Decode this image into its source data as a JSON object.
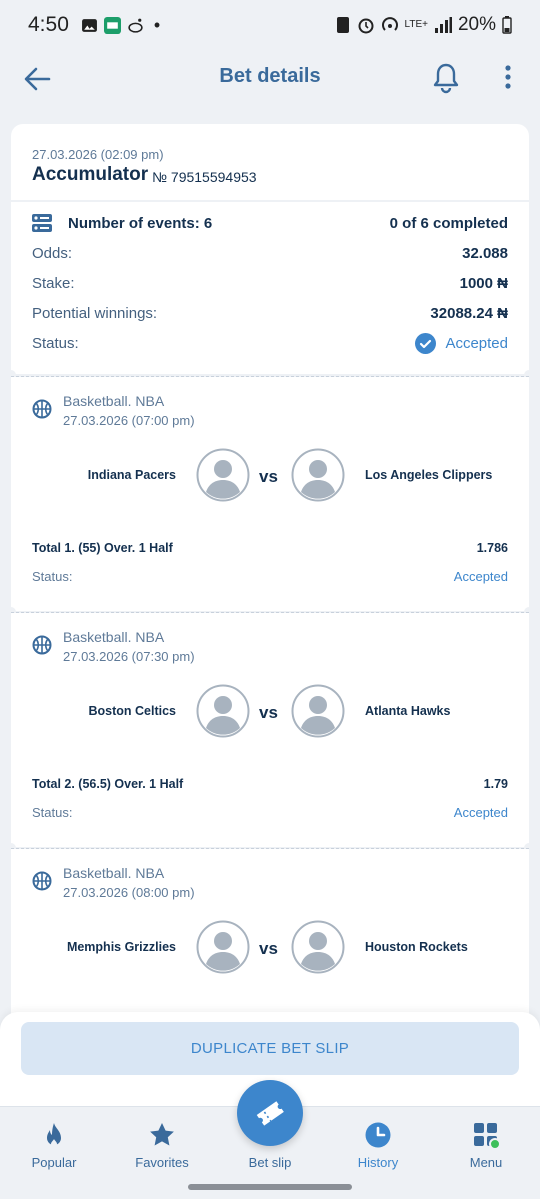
{
  "status_bar": {
    "time": "4:50",
    "network": "LTE+",
    "battery": "20%"
  },
  "app_bar": {
    "title": "Bet details"
  },
  "header": {
    "date": "27.03.2026 (02:09 pm)",
    "type": "Accumulator",
    "number": "№ 79515594953"
  },
  "summary": {
    "events_label": "Number of events: 6",
    "completed": "0 of 6 completed",
    "odds_label": "Odds:",
    "odds_value": "32.088",
    "stake_label": "Stake:",
    "stake_value": "1000 ₦",
    "winnings_label": "Potential winnings:",
    "winnings_value": "32088.24 ₦",
    "status_label": "Status:",
    "status_value": "Accepted"
  },
  "events": [
    {
      "league": "Basketball. NBA",
      "date": "27.03.2026 (07:00 pm)",
      "team1": "Indiana Pacers",
      "vs": "vs",
      "team2": "Los Angeles Clippers",
      "market": "Total 1. (55) Over. 1 Half",
      "odds": "1.786",
      "status_label": "Status:",
      "status": "Accepted"
    },
    {
      "league": "Basketball. NBA",
      "date": "27.03.2026 (07:30 pm)",
      "team1": "Boston Celtics",
      "vs": "vs",
      "team2": "Atlanta Hawks",
      "market": "Total 2. (56.5) Over. 1 Half",
      "odds": "1.79",
      "status_label": "Status:",
      "status": "Accepted"
    },
    {
      "league": "Basketball. NBA",
      "date": "27.03.2026 (08:00 pm)",
      "team1": "Memphis Grizzlies",
      "vs": "vs",
      "team2": "Houston Rockets"
    }
  ],
  "duplicate_button": "DUPLICATE BET SLIP",
  "bottom_nav": {
    "popular": "Popular",
    "favorites": "Favorites",
    "bet_slip": "Bet slip",
    "history": "History",
    "menu": "Menu"
  },
  "colors": {
    "accent": "#3d86cc",
    "primary_text": "#14304f",
    "background": "#eef1f5",
    "menu_badge": "#3dbf5a"
  }
}
